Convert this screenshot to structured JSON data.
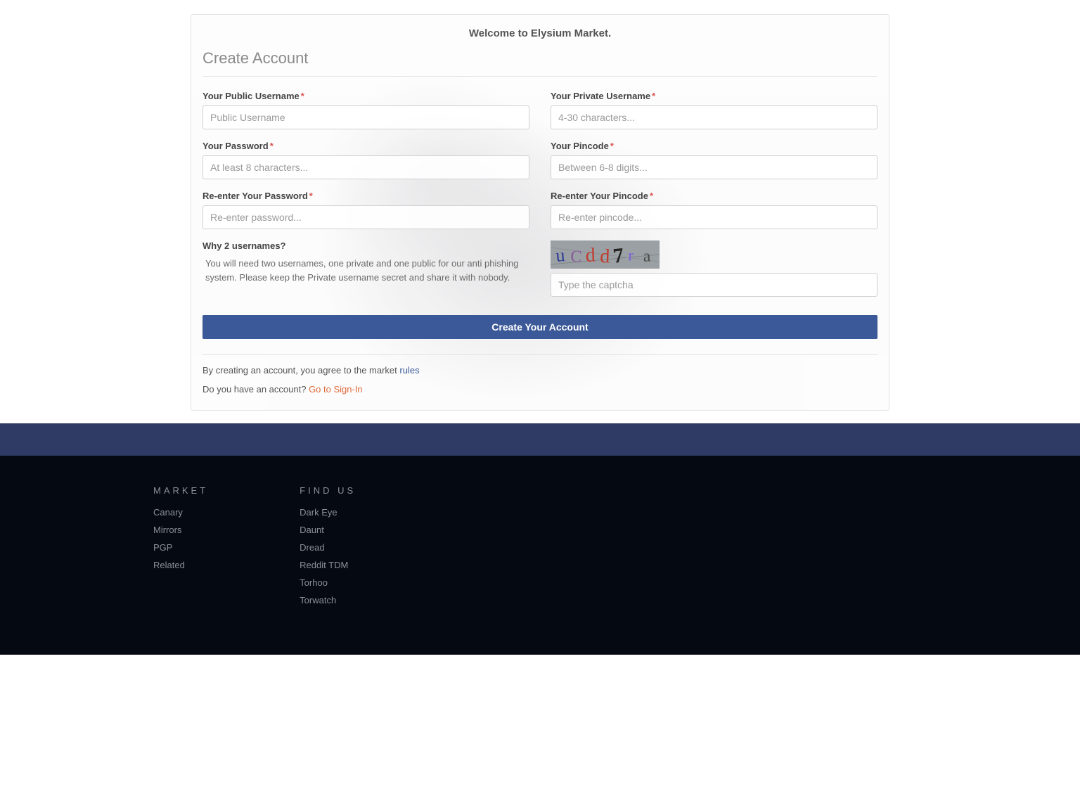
{
  "header": {
    "welcome": "Welcome to Elysium Market.",
    "title": "Create Account"
  },
  "form": {
    "public_username": {
      "label": "Your Public Username",
      "placeholder": "Public Username"
    },
    "private_username": {
      "label": "Your Private Username",
      "placeholder": "4-30 characters..."
    },
    "password": {
      "label": "Your Password",
      "placeholder": "At least 8 characters..."
    },
    "pincode": {
      "label": "Your Pincode",
      "placeholder": "Between 6-8 digits..."
    },
    "password_confirm": {
      "label": "Re-enter Your Password",
      "placeholder": "Re-enter password..."
    },
    "pincode_confirm": {
      "label": "Re-enter Your Pincode",
      "placeholder": "Re-enter pincode..."
    },
    "explain": {
      "title": "Why 2 usernames?",
      "text": "You will need two usernames, one private and one public for our anti phishing system. Please keep the Private username secret and share it with nobody."
    },
    "captcha": {
      "value": "uCdd7ra",
      "placeholder": "Type the captcha"
    },
    "submit_label": "Create Your Account"
  },
  "legal": {
    "agree_prefix": "By creating an account, you agree to the market ",
    "rules_link": "rules",
    "have_account": "Do you have an account? ",
    "signin_link": "Go to Sign-In"
  },
  "footer": {
    "market": {
      "heading": "MARKET",
      "links": [
        "Canary",
        "Mirrors",
        "PGP",
        "Related"
      ]
    },
    "findus": {
      "heading": "FIND US",
      "links": [
        "Dark Eye",
        "Daunt",
        "Dread",
        "Reddit TDM",
        "Torhoo",
        "Torwatch"
      ]
    }
  }
}
